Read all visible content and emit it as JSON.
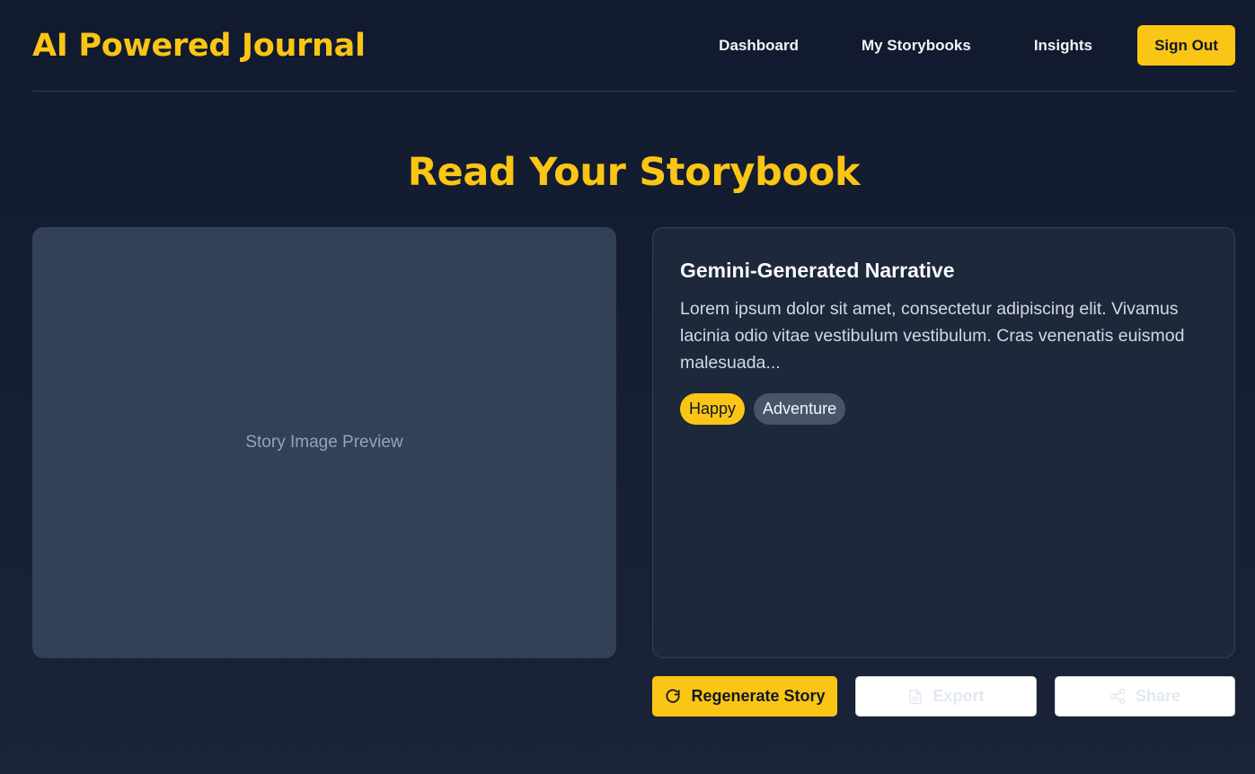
{
  "header": {
    "brand": "AI Powered Journal",
    "nav": [
      "Dashboard",
      "My Storybooks",
      "Insights"
    ],
    "signout_label": "Sign Out"
  },
  "page_title": "Read Your Storybook",
  "image_preview": {
    "label": "Story Image Preview"
  },
  "story": {
    "title": "Gemini-Generated Narrative",
    "text": "Lorem ipsum dolor sit amet, consectetur adipiscing elit. Vivamus lacinia odio vitae vestibulum vestibulum. Cras venenatis euismod malesuada...",
    "tags": [
      "Happy",
      "Adventure"
    ]
  },
  "actions": {
    "regenerate_label": "Regenerate Story",
    "export_label": "Export",
    "share_label": "Share"
  },
  "colors": {
    "accent": "#fac515",
    "background": "#111a2e",
    "card": "#1e283b",
    "image_placeholder": "#334158"
  },
  "icons": {
    "regenerate": "refresh-icon",
    "export": "document-icon",
    "share": "share-icon"
  }
}
